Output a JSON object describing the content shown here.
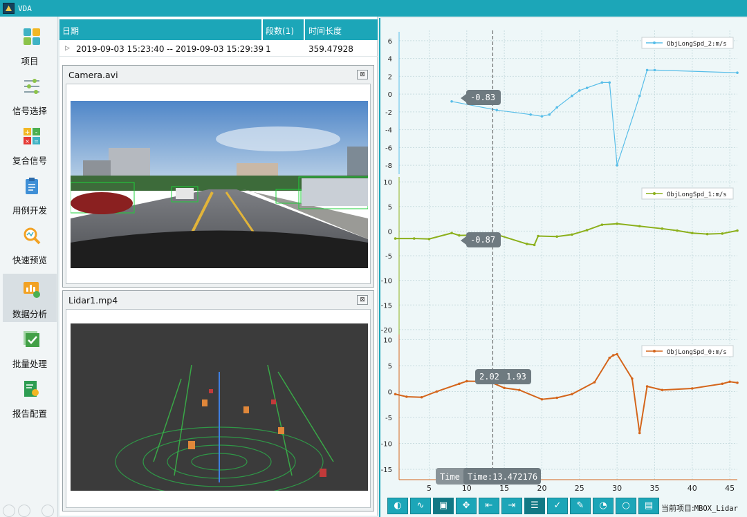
{
  "app": {
    "title": "VDA"
  },
  "sidebar": {
    "items": [
      {
        "label": "项目",
        "icon": "project-grid-icon"
      },
      {
        "label": "信号选择",
        "icon": "signal-select-icon"
      },
      {
        "label": "复合信号",
        "icon": "calculator-icon"
      },
      {
        "label": "用例开发",
        "icon": "clipboard-dev-icon"
      },
      {
        "label": "快速预览",
        "icon": "magnifier-icon"
      },
      {
        "label": "数据分析",
        "icon": "analysis-chart-icon",
        "active": true
      },
      {
        "label": "批量处理",
        "icon": "batch-check-icon"
      },
      {
        "label": "报告配置",
        "icon": "report-icon"
      }
    ]
  },
  "table": {
    "headers": [
      "日期",
      "段数(1)",
      "时间长度"
    ],
    "row": {
      "date": "2019-09-03 15:23:40 -- 2019-09-03 15:29:39",
      "segments": "1",
      "duration": "359.47928"
    }
  },
  "videos": [
    {
      "title": "Camera.avi",
      "close": "⊠"
    },
    {
      "title": "Lidar1.mp4",
      "close": "⊠"
    }
  ],
  "chart_data": [
    {
      "type": "line",
      "series": [
        {
          "name": "ObjLongSpd_2:m/s",
          "x": [
            8,
            14,
            18.5,
            20,
            21,
            22,
            24,
            25,
            26,
            28,
            29,
            30,
            33,
            34,
            35,
            46
          ],
          "values": [
            -0.83,
            -1.8,
            -2.3,
            -2.5,
            -2.3,
            -1.5,
            -0.2,
            0.4,
            0.7,
            1.3,
            1.3,
            -8,
            -0.2,
            2.7,
            2.7,
            2.4
          ]
        }
      ],
      "ylim": [
        -9,
        7
      ],
      "yticks": [
        6,
        4,
        2,
        0,
        -2,
        -4,
        -6,
        -8
      ],
      "tooltip": "-0.83",
      "color": "#56bde8",
      "legend": "top-right"
    },
    {
      "type": "line",
      "series": [
        {
          "name": "ObjLongSpd_1:m/s",
          "x": [
            0.5,
            3,
            5,
            8,
            9,
            14,
            18,
            19,
            19.5,
            22,
            24,
            26,
            28,
            30,
            33,
            36,
            38,
            40,
            42,
            44,
            46
          ],
          "values": [
            -1.5,
            -1.5,
            -1.6,
            -0.4,
            -0.87,
            -0.7,
            -2.6,
            -2.8,
            -1,
            -1.1,
            -0.7,
            0.2,
            1.3,
            1.5,
            1.0,
            0.5,
            0.1,
            -0.4,
            -0.6,
            -0.5,
            0.1
          ]
        }
      ],
      "ylim": [
        -21,
        11
      ],
      "yticks": [
        10,
        5,
        0,
        -5,
        -10,
        -15,
        -20
      ],
      "tooltip": "-0.87",
      "color": "#8cb01c",
      "legend": "top-right"
    },
    {
      "type": "line",
      "series": [
        {
          "name": "ObjLongSpd_0:m/s",
          "x": [
            0.5,
            2,
            4,
            6,
            9,
            10,
            13,
            15,
            17,
            20,
            22,
            24,
            27,
            29,
            29.5,
            30,
            32,
            33,
            34,
            36,
            40,
            44,
            45,
            46
          ],
          "values": [
            -0.5,
            -1,
            -1.1,
            0,
            1.5,
            2.0,
            1.93,
            0.7,
            0.3,
            -1.5,
            -1.2,
            -0.5,
            1.8,
            6.5,
            7,
            7.2,
            2.5,
            -8,
            1,
            0.3,
            0.6,
            1.5,
            1.9,
            1.7
          ]
        }
      ],
      "ylim": [
        -17,
        11
      ],
      "yticks": [
        10,
        5,
        0,
        -5,
        -10,
        -15
      ],
      "xlim": [
        1,
        46
      ],
      "xticks": [
        5,
        10,
        15,
        20,
        25,
        30,
        35,
        40,
        45
      ],
      "tooltips": [
        "2.02",
        "1.93"
      ],
      "color": "#d4651b",
      "legend": "top-right"
    }
  ],
  "cursor": {
    "label_short": "Time",
    "label": "Time:13.472176",
    "x": 13.472176
  },
  "toolbar": {
    "buttons": [
      {
        "name": "palette-icon",
        "glyph": "◐"
      },
      {
        "name": "wave-icon",
        "glyph": "∿"
      },
      {
        "name": "select-box-icon",
        "glyph": "▣",
        "selected": true
      },
      {
        "name": "move-icon",
        "glyph": "✥"
      },
      {
        "name": "cursor-left-icon",
        "glyph": "⇤"
      },
      {
        "name": "cursor-right-icon",
        "glyph": "⇥"
      },
      {
        "name": "list-icon",
        "glyph": "☰",
        "selected": true
      },
      {
        "name": "check-icon",
        "glyph": "✓"
      },
      {
        "name": "pin-icon",
        "glyph": "✎"
      },
      {
        "name": "pie-icon",
        "glyph": "◔"
      },
      {
        "name": "circle-icon",
        "glyph": "○"
      },
      {
        "name": "save-icon",
        "glyph": "▤"
      }
    ]
  },
  "status": {
    "label": "当前项目:",
    "value": "MBOX_Lidar"
  }
}
